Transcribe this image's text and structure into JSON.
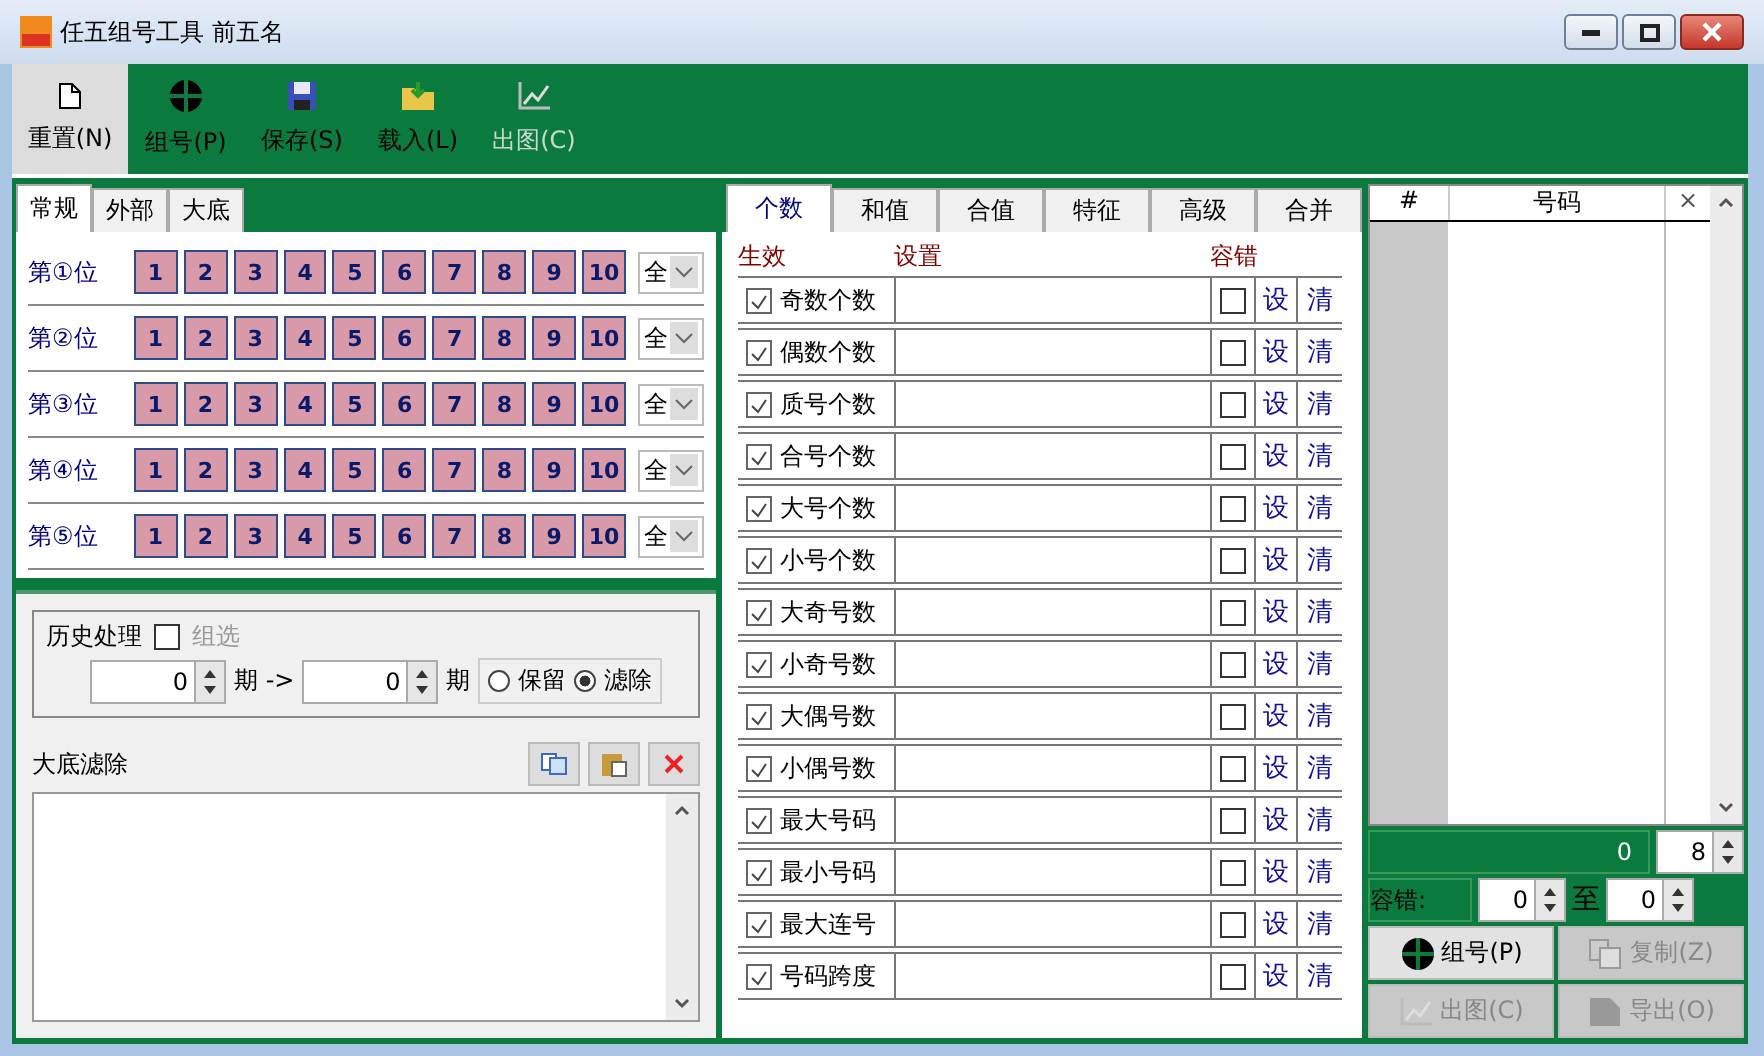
{
  "window": {
    "title": "任五组号工具 前五名"
  },
  "toolbar": [
    {
      "kind": "new",
      "label": "重置(N)",
      "selected": true,
      "disabled": false
    },
    {
      "kind": "group",
      "label": "组号(P)",
      "selected": false,
      "disabled": false
    },
    {
      "kind": "save",
      "label": "保存(S)",
      "selected": false,
      "disabled": false
    },
    {
      "kind": "load",
      "label": "载入(L)",
      "selected": false,
      "disabled": false
    },
    {
      "kind": "chart",
      "label": "出图(C)",
      "selected": false,
      "disabled": true
    }
  ],
  "left_tabs": [
    {
      "label": "常规",
      "selected": true
    },
    {
      "label": "外部",
      "selected": false
    },
    {
      "label": "大底",
      "selected": false
    }
  ],
  "positions": [
    {
      "label": "第①位",
      "numbers": [
        "1",
        "2",
        "3",
        "4",
        "5",
        "6",
        "7",
        "8",
        "9",
        "10"
      ],
      "choice": "全"
    },
    {
      "label": "第②位",
      "numbers": [
        "1",
        "2",
        "3",
        "4",
        "5",
        "6",
        "7",
        "8",
        "9",
        "10"
      ],
      "choice": "全"
    },
    {
      "label": "第③位",
      "numbers": [
        "1",
        "2",
        "3",
        "4",
        "5",
        "6",
        "7",
        "8",
        "9",
        "10"
      ],
      "choice": "全"
    },
    {
      "label": "第④位",
      "numbers": [
        "1",
        "2",
        "3",
        "4",
        "5",
        "6",
        "7",
        "8",
        "9",
        "10"
      ],
      "choice": "全"
    },
    {
      "label": "第⑤位",
      "numbers": [
        "1",
        "2",
        "3",
        "4",
        "5",
        "6",
        "7",
        "8",
        "9",
        "10"
      ],
      "choice": "全"
    }
  ],
  "history": {
    "title": "历史处理",
    "group_check": {
      "label": "组选",
      "checked": false,
      "disabled": true
    },
    "from": "0",
    "from_unit": "期 ->",
    "to": "0",
    "to_unit": "期",
    "options": [
      {
        "label": "保留",
        "selected": false
      },
      {
        "label": "滤除",
        "selected": true
      }
    ]
  },
  "dadi": {
    "title": "大底滤除"
  },
  "middle_tabs": [
    {
      "label": "个数",
      "selected": true
    },
    {
      "label": "和值",
      "selected": false
    },
    {
      "label": "合值",
      "selected": false
    },
    {
      "label": "特征",
      "selected": false
    },
    {
      "label": "高级",
      "selected": false
    },
    {
      "label": "合并",
      "selected": false
    }
  ],
  "filter_header": {
    "enable": "生效",
    "setting": "设置",
    "tolerance": "容错"
  },
  "filters": [
    {
      "label": "奇数个数",
      "enabled": true,
      "tolerance": false,
      "set": "设",
      "clear": "清"
    },
    {
      "label": "偶数个数",
      "enabled": true,
      "tolerance": false,
      "set": "设",
      "clear": "清"
    },
    {
      "label": "质号个数",
      "enabled": true,
      "tolerance": false,
      "set": "设",
      "clear": "清"
    },
    {
      "label": "合号个数",
      "enabled": true,
      "tolerance": false,
      "set": "设",
      "clear": "清"
    },
    {
      "label": "大号个数",
      "enabled": true,
      "tolerance": false,
      "set": "设",
      "clear": "清"
    },
    {
      "label": "小号个数",
      "enabled": true,
      "tolerance": false,
      "set": "设",
      "clear": "清"
    },
    {
      "label": "大奇号数",
      "enabled": true,
      "tolerance": false,
      "set": "设",
      "clear": "清"
    },
    {
      "label": "小奇号数",
      "enabled": true,
      "tolerance": false,
      "set": "设",
      "clear": "清"
    },
    {
      "label": "大偶号数",
      "enabled": true,
      "tolerance": false,
      "set": "设",
      "clear": "清"
    },
    {
      "label": "小偶号数",
      "enabled": true,
      "tolerance": false,
      "set": "设",
      "clear": "清"
    },
    {
      "label": "最大号码",
      "enabled": true,
      "tolerance": false,
      "set": "设",
      "clear": "清"
    },
    {
      "label": "最小号码",
      "enabled": true,
      "tolerance": false,
      "set": "设",
      "clear": "清"
    },
    {
      "label": "最大连号",
      "enabled": true,
      "tolerance": false,
      "set": "设",
      "clear": "清"
    },
    {
      "label": "号码跨度",
      "enabled": true,
      "tolerance": false,
      "set": "设",
      "clear": "清"
    }
  ],
  "results": {
    "columns": [
      "#",
      "号码",
      "×"
    ],
    "count": "0",
    "spin": "8",
    "tolerance_label": "容错:",
    "tol_from": "0",
    "tol_to_label": "至",
    "tol_to": "0"
  },
  "actions": [
    {
      "kind": "group",
      "label": "组号(P)",
      "disabled": false
    },
    {
      "kind": "copy",
      "label": "复制(Z)",
      "disabled": true
    },
    {
      "kind": "chart",
      "label": "出图(C)",
      "disabled": true
    },
    {
      "kind": "export",
      "label": "导出(O)",
      "disabled": true
    }
  ]
}
